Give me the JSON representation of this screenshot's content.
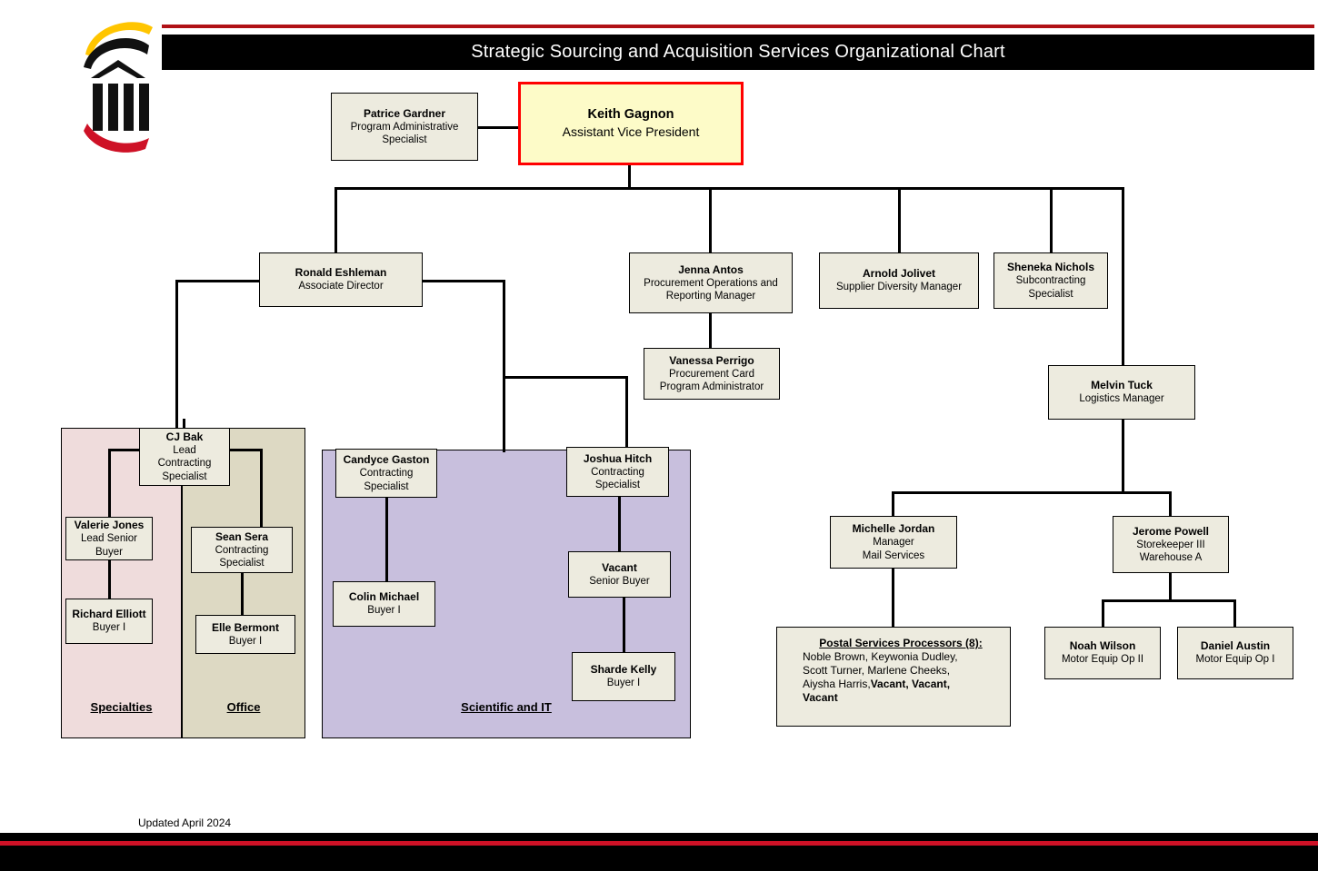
{
  "header": {
    "title": "Strategic Sourcing and Acquisition Services Organizational Chart",
    "logo_icon": "university-column-logo-icon",
    "accent_red": "#B01116",
    "bar_black": "#000000"
  },
  "footer": {
    "updated": "Updated April 2024",
    "stripe_red": "#CE1126"
  },
  "colors": {
    "node_fill": "#EDEBDF",
    "root_fill": "#FDFBC8",
    "root_border": "#FF0000",
    "specialties_fill": "#EFDCDC",
    "office_fill": "#DDD9C3",
    "scientific_fill": "#C8BFDD"
  },
  "nodes": {
    "gardner": {
      "name": "Patrice Gardner",
      "title1": "Program Administrative",
      "title2": "Specialist"
    },
    "gagnon": {
      "name": "Keith Gagnon",
      "title1": "Assistant Vice President"
    },
    "eshleman": {
      "name": "Ronald  Eshleman",
      "title1": "Associate Director"
    },
    "antos": {
      "name": "Jenna Antos",
      "title1": "Procurement Operations and",
      "title2": "Reporting Manager"
    },
    "jolivet": {
      "name": "Arnold  Jolivet",
      "title1": "Supplier Diversity Manager"
    },
    "nichols": {
      "name": "Sheneka Nichols",
      "title1": "Subcontracting",
      "title2": "Specialist"
    },
    "perrigo": {
      "name": "Vanessa Perrigo",
      "title1": "Procurement Card",
      "title2": "Program Administrator"
    },
    "tuck": {
      "name": "Melvin  Tuck",
      "title1": "Logistics Manager"
    },
    "bak": {
      "name": "CJ Bak",
      "title1": "Lead",
      "title2": "Contracting",
      "title3": "Specialist"
    },
    "jones": {
      "name": "Valerie Jones",
      "title1": "Lead Senior",
      "title2": "Buyer"
    },
    "elliott": {
      "name": "Richard Elliott",
      "title1": "Buyer I"
    },
    "sera": {
      "name": "Sean Sera",
      "title1": "Contracting",
      "title2": "Specialist"
    },
    "bermont": {
      "name": "Elle  Bermont",
      "title1": "Buyer I"
    },
    "gaston": {
      "name": "Candyce Gaston",
      "title1": "Contracting",
      "title2": "Specialist"
    },
    "colin": {
      "name": "Colin  Michael",
      "title1": "Buyer I"
    },
    "hitch": {
      "name": "Joshua Hitch",
      "title1": "Contracting",
      "title2": "Specialist"
    },
    "vacant_sb": {
      "name": "Vacant",
      "title1": "Senior Buyer"
    },
    "kelly": {
      "name": "Sharde Kelly",
      "title1": "Buyer I"
    },
    "jordan": {
      "name": "Michelle  Jordan",
      "title1": "Manager",
      "title2": "Mail Services"
    },
    "powell": {
      "name": "Jerome Powell",
      "title1": "Storekeeper III",
      "title2": "Warehouse A"
    },
    "wilson": {
      "name": "Noah Wilson",
      "title1": "Motor Equip Op II"
    },
    "austin": {
      "name": "Daniel Austin",
      "title1": "Motor Equip Op I"
    }
  },
  "postal": {
    "heading": "Postal Services Processors (8):",
    "line1": "Noble Brown,  Keywonia Dudley,",
    "line2": "Scott Turner, Marlene Cheeks,",
    "line3_plain": "Aiysha Harris,",
    "line3_bold": "Vacant, Vacant,",
    "line4_bold": "Vacant"
  },
  "groups": {
    "specialties": "Specialties",
    "office": "Office",
    "scientific": "Scientific and IT"
  }
}
